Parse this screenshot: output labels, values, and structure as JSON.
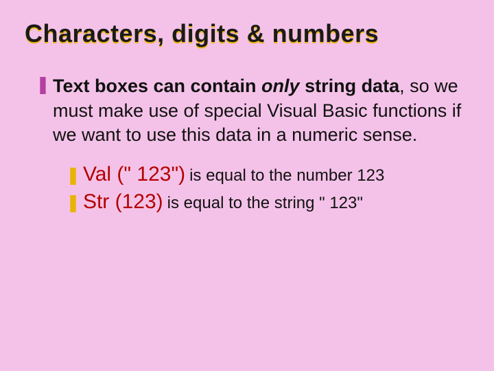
{
  "title": "Characters, digits & numbers",
  "main": {
    "bold_lead": "Text boxes can contain ",
    "bold_italic": "only",
    "bold_tail": " string data",
    "rest": ", so we must make use of special Visual Basic functions if we want to use this data in a numeric sense."
  },
  "subs": [
    {
      "fn": "Val (\" 123\")",
      "desc": "is equal to the number 123"
    },
    {
      "fn": "Str (123)",
      "desc": "is equal to the string \" 123\""
    }
  ]
}
